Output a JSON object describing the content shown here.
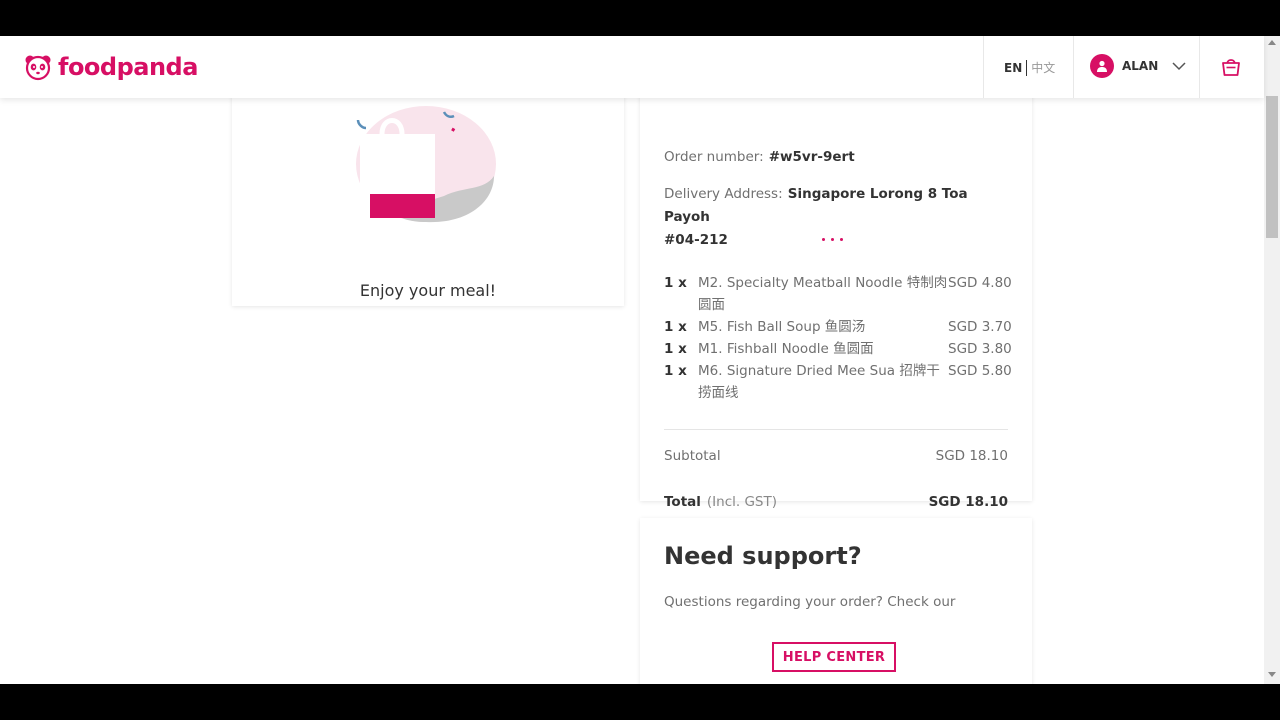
{
  "header": {
    "brand": "foodpanda",
    "lang_en": "EN",
    "lang_zh": "中文",
    "user_name": "ALAN",
    "accent_color": "#d70f64"
  },
  "confirmation": {
    "message": "Enjoy your meal!"
  },
  "order": {
    "order_number_label": "Order number:",
    "order_number": "#w5vr-9ert",
    "address_label": "Delivery Address:",
    "address_line1": "Singapore Lorong 8 Toa Payoh",
    "address_line2": "#04-212",
    "items": [
      {
        "qty": "1 x",
        "name_line1": "M2. Specialty Meatball Noodle 特制肉",
        "name_line2": "圆面",
        "price": "SGD 4.80"
      },
      {
        "qty": "1 x",
        "name_line1": "M5. Fish Ball Soup 鱼圆汤",
        "name_line2": "",
        "price": "SGD 3.70"
      },
      {
        "qty": "1 x",
        "name_line1": "M1. Fishball Noodle 鱼圆面",
        "name_line2": "",
        "price": "SGD 3.80"
      },
      {
        "qty": "1 x",
        "name_line1": "M6. Signature Dried Mee Sua 招牌干",
        "name_line2": "捞面线",
        "price": "SGD 5.80"
      }
    ],
    "subtotal_label": "Subtotal",
    "subtotal": "SGD 18.10",
    "total_label": "Total",
    "total_note": "(Incl. GST)",
    "total": "SGD 18.10"
  },
  "support": {
    "title": "Need support?",
    "text": "Questions regarding your order? Check our",
    "button": "HELP CENTER"
  }
}
